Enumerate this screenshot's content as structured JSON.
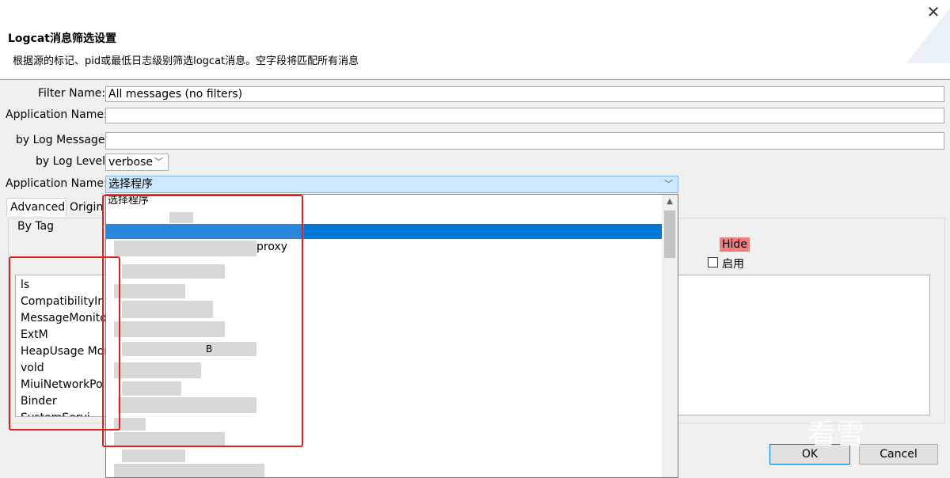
{
  "dialog": {
    "title": "Logcat消息筛选设置",
    "description": "根据源的标记、pid或最低日志级别筛选logcat消息。空字段将匹配所有消息",
    "close_glyph": "✕"
  },
  "form": {
    "filter_name_label": "Filter Name:",
    "filter_name_value": "All messages (no filters)",
    "app_name_label": "Application Name:",
    "app_name_value": "",
    "log_message_label": "by Log Message:",
    "log_message_value": "",
    "log_level_label": "by Log Level:",
    "log_level_value": "verbose",
    "app_name2_label": "Application Name:",
    "app_name2_value": "选择程序"
  },
  "tabs": [
    {
      "label": "Advanced"
    },
    {
      "label": "Origin"
    }
  ],
  "by_tag": {
    "group_label": "By Tag",
    "tags": [
      "ls",
      "CompatibilityIn",
      "MessageMonito",
      "ExtM",
      "HeapUsage Mon",
      "vold",
      "MiuiNetworkPo",
      "Binder",
      "SystemServi"
    ],
    "hide_label": "Hide",
    "enable_label": "启用"
  },
  "dropdown": {
    "items": [
      "选择程序",
      "proxy",
      "B"
    ]
  },
  "buttons": {
    "ok": "OK",
    "cancel": "Cancel"
  },
  "watermark": "看雪",
  "icons": {
    "close": "close-icon",
    "arrow": "chevron-down-icon",
    "scroll_up": "scroll-up-icon"
  },
  "colors": {
    "selection": "#0078d7",
    "combo_selected": "#cde8ff",
    "hide_tag": "#ef7f7f",
    "annotation": "#e02020"
  }
}
